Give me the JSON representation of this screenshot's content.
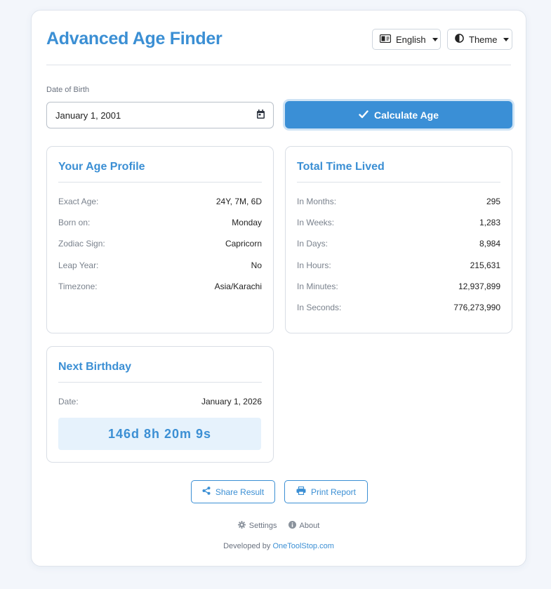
{
  "header": {
    "title": "Advanced Age Finder",
    "language_label": "English",
    "theme_label": "Theme"
  },
  "form": {
    "dob_label": "Date of Birth",
    "dob_value": "January 1, 2001",
    "calculate_label": "Calculate Age"
  },
  "profile": {
    "title": "Your Age Profile",
    "rows": [
      {
        "k": "Exact Age:",
        "v": "24Y, 7M, 6D"
      },
      {
        "k": "Born on:",
        "v": "Monday"
      },
      {
        "k": "Zodiac Sign:",
        "v": "Capricorn"
      },
      {
        "k": "Leap Year:",
        "v": "No"
      },
      {
        "k": "Timezone:",
        "v": "Asia/Karachi"
      }
    ]
  },
  "total": {
    "title": "Total Time Lived",
    "rows": [
      {
        "k": "In Months:",
        "v": "295"
      },
      {
        "k": "In Weeks:",
        "v": "1,283"
      },
      {
        "k": "In Days:",
        "v": "8,984"
      },
      {
        "k": "In Hours:",
        "v": "215,631"
      },
      {
        "k": "In Minutes:",
        "v": "12,937,899"
      },
      {
        "k": "In Seconds:",
        "v": "776,273,990"
      }
    ]
  },
  "next_birthday": {
    "title": "Next Birthday",
    "date_label": "Date:",
    "date_value": "January 1, 2026",
    "countdown": "146d 8h 20m 9s"
  },
  "actions": {
    "share_label": "Share Result",
    "print_label": "Print Report"
  },
  "footer": {
    "settings_label": "Settings",
    "about_label": "About",
    "credit_prefix": "Developed by",
    "credit_link": "OneToolStop.com"
  },
  "colors": {
    "accent": "#3b8fd4",
    "countdown_bg": "#e6f2fc"
  }
}
